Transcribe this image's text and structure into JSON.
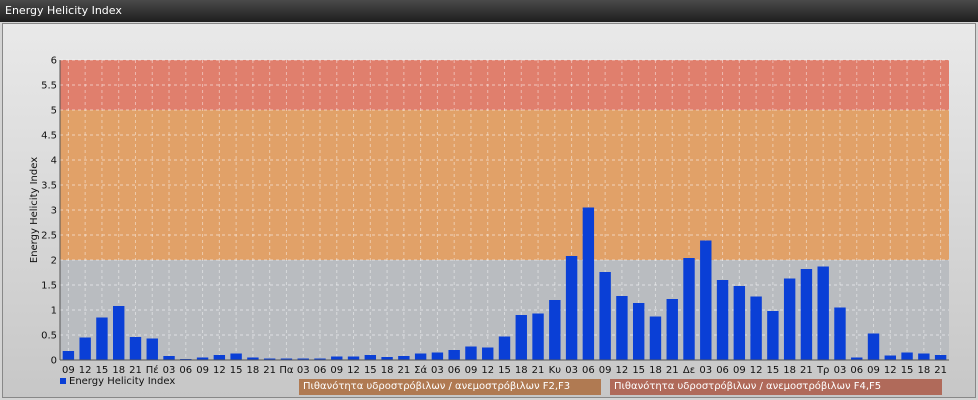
{
  "window": {
    "title": "Energy Helicity Index"
  },
  "legend": {
    "series_label": "Energy Helicity Index",
    "band1_label": "Πιθανότητα υδροστρόβιλων / ανεμοστρόβιλων F2,F3",
    "band2_label": "Πιθανότητα υδροστρόβιλων / ανεμοστρόβιλων F4,F5"
  },
  "colors": {
    "bar": "#0a3fd6",
    "band_low": "#b9bcc0",
    "band_mid": "#e1a168",
    "band_high": "#e07f6d",
    "band1_legend": "#b07a52",
    "band2_legend": "#b06a5a"
  },
  "chart_data": {
    "type": "bar",
    "title": "",
    "ylabel": "Energy Helicity Index",
    "xlabel": "",
    "ylim": [
      0,
      6
    ],
    "yticks": [
      "0",
      "0.5",
      "1",
      "1.5",
      "2",
      "2.5",
      "3",
      "3.5",
      "4",
      "4.5",
      "5",
      "5.5",
      "6"
    ],
    "grid": true,
    "bands": [
      {
        "from": 0,
        "to": 2
      },
      {
        "from": 2,
        "to": 5
      },
      {
        "from": 5,
        "to": 6
      }
    ],
    "categories": [
      "09",
      "12",
      "15",
      "18",
      "21",
      "Πέ",
      "03",
      "06",
      "09",
      "12",
      "15",
      "18",
      "21",
      "Πα",
      "03",
      "06",
      "09",
      "12",
      "15",
      "18",
      "21",
      "Σά",
      "03",
      "06",
      "09",
      "12",
      "15",
      "18",
      "21",
      "Κυ",
      "03",
      "06",
      "09",
      "12",
      "15",
      "18",
      "21",
      "Δε",
      "03",
      "06",
      "09",
      "12",
      "15",
      "18",
      "21",
      "Τρ",
      "03",
      "06",
      "09",
      "12",
      "15",
      "18",
      "21"
    ],
    "series": [
      {
        "values": [
          0.18,
          0.45,
          0.85,
          1.08,
          0.46,
          0.43,
          0.08,
          0.02,
          0.05,
          0.1,
          0.13,
          0.05,
          0.03,
          0.03,
          0.03,
          0.03,
          0.07,
          0.07,
          0.1,
          0.06,
          0.08,
          0.13,
          0.15,
          0.2,
          0.27,
          0.25,
          0.47,
          0.9,
          0.93,
          1.2,
          2.08,
          3.05,
          1.76,
          1.28,
          1.14,
          0.87,
          1.22,
          2.04,
          2.39,
          1.6,
          1.48,
          1.27,
          0.98,
          1.63,
          1.82,
          1.87,
          1.05,
          0.05,
          0.53,
          0.09,
          0.15,
          0.13,
          0.1
        ]
      }
    ]
  }
}
